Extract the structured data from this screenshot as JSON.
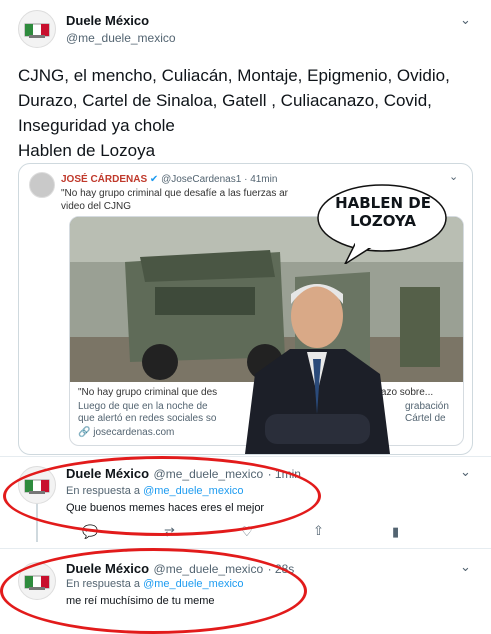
{
  "main_tweet": {
    "author": "Duele México",
    "handle": "@me_duele_mexico",
    "text_lines": [
      "CJNG, el mencho, Culiacán, Montaje, Epigmenio, Ovidio,",
      "Durazo, Cartel de Sinaloa, Gatell , Culiacanazo, Covid,",
      "Inseguridad ya chole",
      "Hablen de Lozoya"
    ],
    "quoted": {
      "author": "JOSÉ CÁRDENAS",
      "handle": "@JoseCardenas1",
      "time": "41min",
      "text": "\"No hay grupo criminal que desafíe a las fuerzas ar",
      "text2": "video del CJNG",
      "card_title": "\"No hay grupo criminal que des",
      "card_title_end": "urazo sobre...",
      "card_desc1": "Luego de que en la noche de",
      "card_desc1_end": "grabación",
      "card_desc2": "que alertó en redes sociales so",
      "card_desc2_end": "Cártel de",
      "card_link": "josecardenas.com",
      "meme_text": "HABLEN DE LOZOYA"
    }
  },
  "replies": [
    {
      "author": "Duele México",
      "handle": "@me_duele_mexico",
      "time": "1min",
      "reply_prefix": "En respuesta a",
      "reply_to": "@me_duele_mexico",
      "text": "Que buenos memes haces eres el mejor"
    },
    {
      "author": "Duele México",
      "handle": "@me_duele_mexico",
      "time": "28s",
      "reply_prefix": "En respuesta a",
      "reply_to": "@me_duele_mexico",
      "text": "me reí muchísimo de tu meme"
    }
  ],
  "colors": {
    "annotation": "#e21b1b",
    "link": "#1d9bf0"
  }
}
